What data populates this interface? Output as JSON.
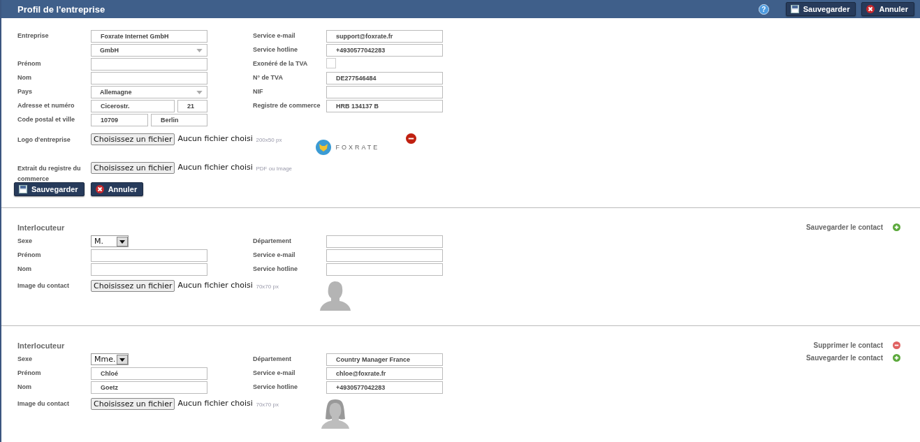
{
  "header": {
    "title": "Profil de l'entreprise",
    "help": "?",
    "buttons": [
      {
        "kind": "save",
        "label": "Sauvegarder"
      },
      {
        "kind": "cancel",
        "label": "Annuler"
      }
    ]
  },
  "company": {
    "left": [
      {
        "kind": "text",
        "label": "Entreprise",
        "value": "Foxrate Internet GmbH"
      },
      {
        "kind": "select",
        "value": "GmbH"
      },
      {
        "kind": "text",
        "label": "Prénom"
      },
      {
        "kind": "text",
        "label": "Nom"
      },
      {
        "kind": "select",
        "label": "Pays",
        "value": "Allemagne"
      },
      {
        "kind": "street",
        "label": "Adresse et numéro",
        "values": [
          "Cicerostr.",
          "21"
        ]
      },
      {
        "kind": "city",
        "label": "Code postal et ville",
        "values": [
          "10709",
          "Berlin"
        ]
      }
    ],
    "right": [
      {
        "kind": "text",
        "label": "Service e-mail",
        "value": "support@foxrate.fr"
      },
      {
        "kind": "text",
        "label": "Service hotline",
        "value": "+4930577042283"
      },
      {
        "kind": "checkbox",
        "label": "Exonéré de la TVA",
        "checked": false
      },
      {
        "kind": "text",
        "label": "N° de TVA",
        "value": "DE277546484"
      },
      {
        "kind": "text",
        "label": "NIF"
      },
      {
        "kind": "text",
        "label": "Registre de commerce",
        "value": "HRB 134137 B"
      }
    ],
    "files": [
      {
        "label": "Logo d'entreprise",
        "button": "Choisissez un fichier",
        "status": "Aucun fichier choisi",
        "hint": "200x50 px",
        "logo_text": "FOXRATE"
      },
      {
        "label": "Extrait du registre du commerce",
        "button": "Choisissez un fichier",
        "status": "Aucun fichier choisi",
        "hint": "PDF ou Image"
      }
    ],
    "buttons": [
      {
        "kind": "save",
        "label": "Sauvegarder"
      },
      {
        "kind": "cancel",
        "label": "Annuler"
      }
    ]
  },
  "contacts": [
    {
      "title": "Interlocuteur",
      "actions": [
        {
          "kind": "save",
          "label": "Sauvegarder le contact"
        }
      ],
      "left": [
        {
          "kind": "sex",
          "label": "Sexe",
          "value": "M."
        },
        {
          "kind": "text",
          "label": "Prénom"
        },
        {
          "kind": "text",
          "label": "Nom"
        }
      ],
      "right": [
        {
          "kind": "text",
          "label": "Département"
        },
        {
          "kind": "text",
          "label": "Service e-mail"
        },
        {
          "kind": "text",
          "label": "Service hotline"
        }
      ],
      "file": {
        "label": "Image du contact",
        "button": "Choisissez un fichier",
        "status": "Aucun fichier choisi",
        "hint": "70x70 px"
      },
      "avatar": {
        "kind": "male"
      }
    },
    {
      "title": "Interlocuteur",
      "actions": [
        {
          "kind": "delete",
          "label": "Supprimer le contact"
        },
        {
          "kind": "save",
          "label": "Sauvegarder le contact"
        }
      ],
      "left": [
        {
          "kind": "sex",
          "label": "Sexe",
          "value": "Mme."
        },
        {
          "kind": "text",
          "label": "Prénom",
          "value": "Chloé"
        },
        {
          "kind": "text",
          "label": "Nom",
          "value": "Goetz"
        }
      ],
      "right": [
        {
          "kind": "text",
          "label": "Département",
          "value": "Country Manager France"
        },
        {
          "kind": "text",
          "label": "Service e-mail",
          "value": "chloe@foxrate.fr"
        },
        {
          "kind": "text",
          "label": "Service hotline",
          "value": "+4930577042283"
        }
      ],
      "file": {
        "label": "Image du contact",
        "button": "Choisissez un fichier",
        "status": "Aucun fichier choisi",
        "hint": "70x70 px"
      },
      "avatar": {
        "kind": "female"
      }
    }
  ]
}
